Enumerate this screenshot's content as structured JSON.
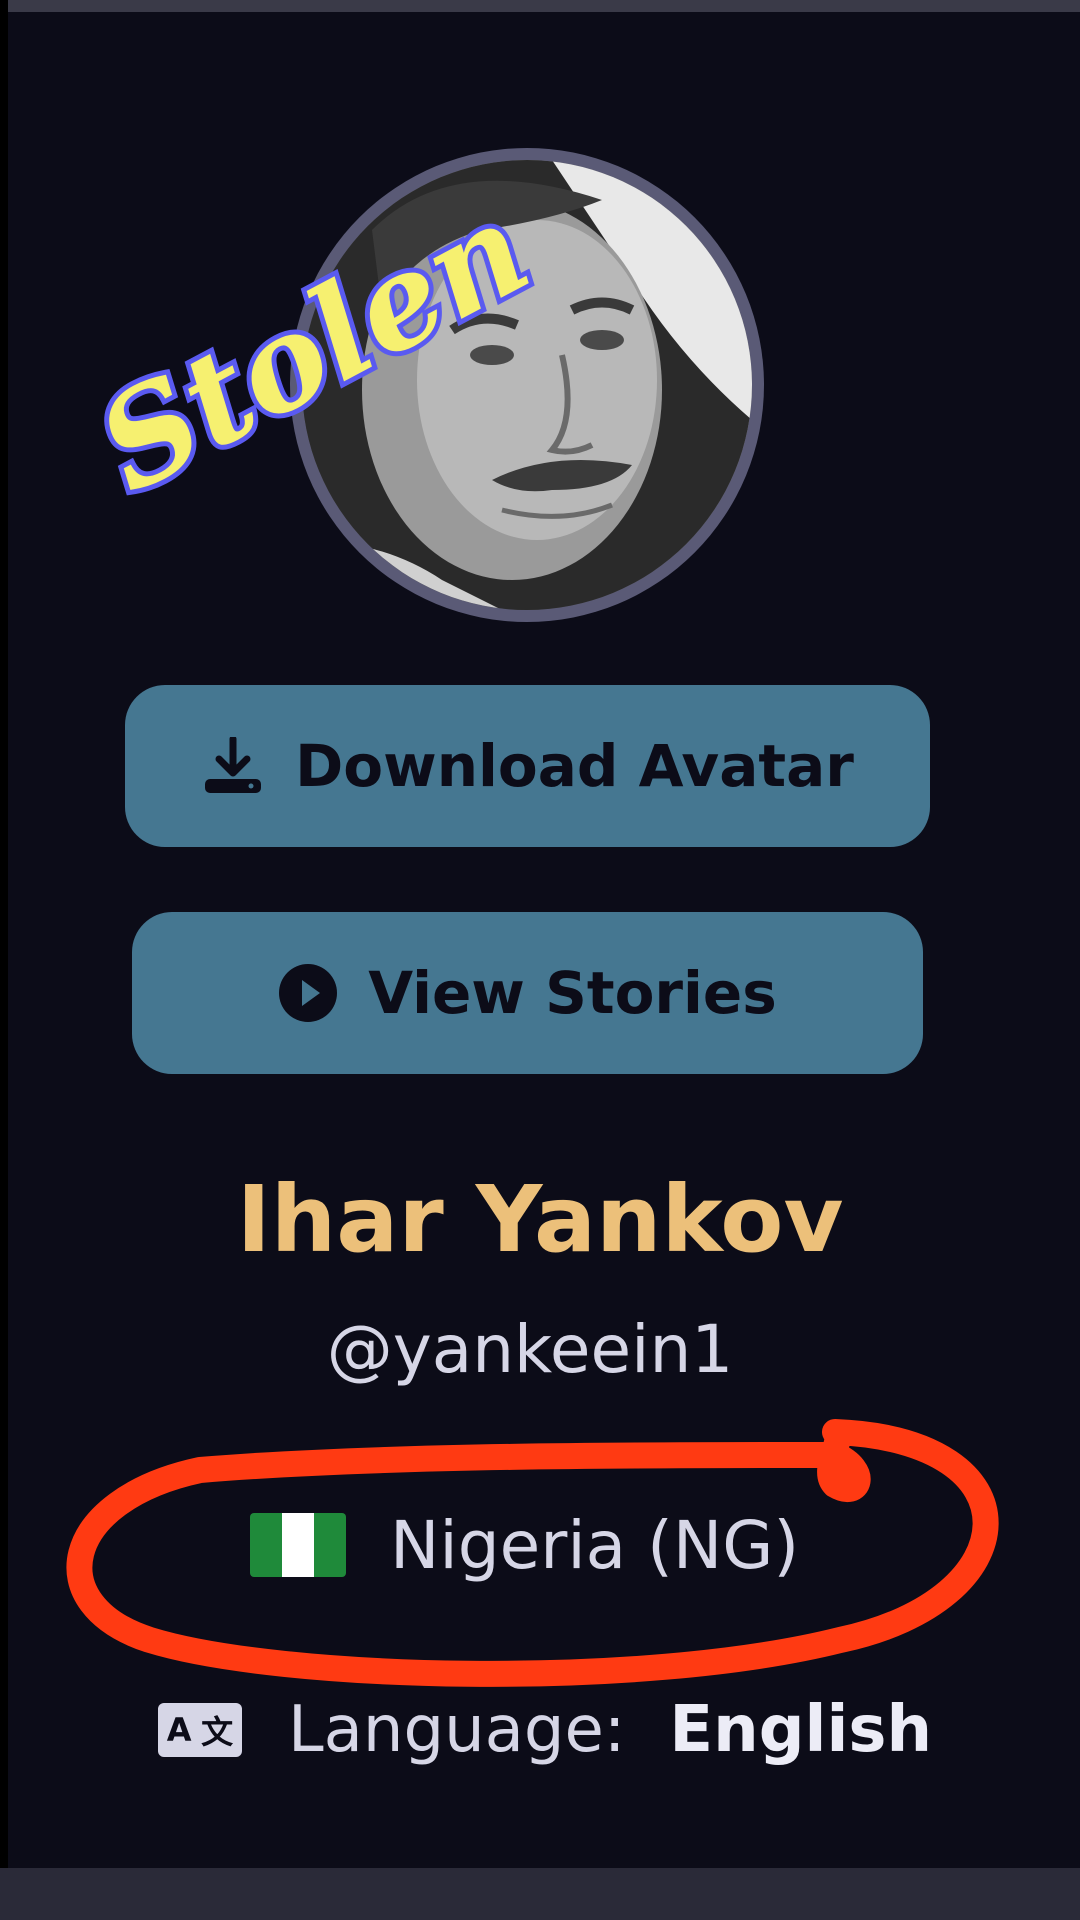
{
  "overlay": {
    "stamp_text": "Stolen"
  },
  "profile": {
    "avatar_alt": "profile-avatar",
    "name": "Ihar Yankov",
    "username": "@yankeein1",
    "country": "Nigeria (NG)",
    "language_label": "Language:",
    "language_value": "English"
  },
  "actions": {
    "download_label": "Download Avatar",
    "stories_label": "View Stories"
  },
  "icons": {
    "download": "download-icon",
    "stories": "play-circle-icon",
    "flag": "nigeria-flag-icon",
    "language": "translate-icon"
  },
  "language_icon": {
    "left_glyph": "A",
    "right_glyph": "文"
  },
  "colors": {
    "background": "#0c0c18",
    "button": "#457791",
    "name": "#ecc07a",
    "scribble": "#ff3a12",
    "stamp_fill": "#f6f070",
    "stamp_outline": "#5a5af0"
  }
}
